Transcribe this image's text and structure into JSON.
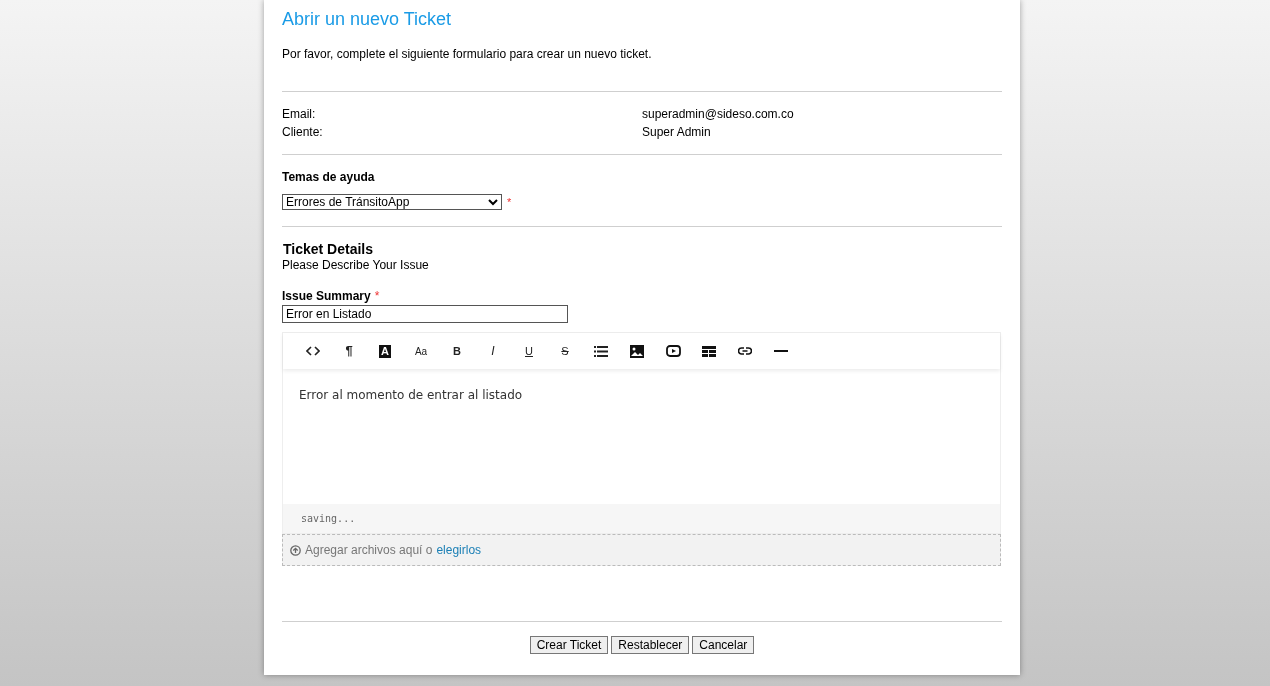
{
  "heading": "Abrir un nuevo Ticket",
  "intro": "Por favor, complete el siguiente formulario para crear un nuevo ticket.",
  "user_info": [
    {
      "label": "Email:",
      "value": "superadmin@sideso.com.co"
    },
    {
      "label": "Cliente:",
      "value": "Super Admin"
    }
  ],
  "help_topic": {
    "label": "Temas de ayuda",
    "value": "Errores de TránsitoApp",
    "required_mark": "*"
  },
  "details": {
    "title": "Ticket Details",
    "subtitle": "Please Describe Your Issue"
  },
  "summary": {
    "label": "Issue Summary",
    "required_mark": "*",
    "value": "Error en Listado"
  },
  "editor": {
    "toolbar": [
      {
        "kind": "code"
      },
      {
        "kind": "text",
        "glyph": "¶"
      },
      {
        "kind": "boxed",
        "glyph": "A"
      },
      {
        "kind": "small",
        "glyph": "Aa"
      },
      {
        "kind": "bold",
        "glyph": "B"
      },
      {
        "kind": "italic",
        "glyph": "I"
      },
      {
        "kind": "underline",
        "glyph": "U"
      },
      {
        "kind": "strike",
        "glyph": "S"
      },
      {
        "kind": "list"
      },
      {
        "kind": "image"
      },
      {
        "kind": "video"
      },
      {
        "kind": "table"
      },
      {
        "kind": "link"
      },
      {
        "kind": "rule"
      }
    ],
    "body": "Error al momento de entrar al listado",
    "status": "saving..."
  },
  "attachments": {
    "text": "Agregar archivos aquí o",
    "link": "elegirlos"
  },
  "buttons": [
    "Crear Ticket",
    "Restablecer",
    "Cancelar"
  ]
}
